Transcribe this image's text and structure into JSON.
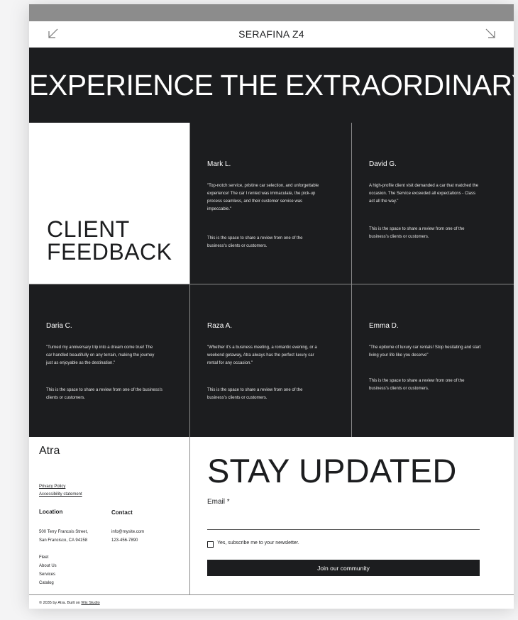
{
  "header": {
    "site_title": "SERAFINA Z4",
    "left_icon": "arrow-down-left-icon",
    "right_icon": "arrow-down-right-icon"
  },
  "hero": {
    "title": "EXPERIENCE THE EXTRAORDINARY"
  },
  "feedback": {
    "title_line1": "CLIENT",
    "title_line2": "FEEDBACK",
    "reviews": [
      {
        "name": "Mark L.",
        "quote": "\"Top-notch service, pristine car selection, and unforgettable experience! The car I rented was immaculate, the pick-up process seamless, and their customer service was impeccable.\"",
        "note": "This is the space to share a review from one of the business's clients or customers."
      },
      {
        "name": "David G.",
        "quote": "A high-profile client visit demanded a car that matched the occasion. The Service exceeded all expectations - Class act all the way.\"",
        "note": "This is the space to share a review from one of the business's clients or customers."
      },
      {
        "name": "Daria C.",
        "quote": "\"Turned my anniversary trip into a dream come true! The car handled beautifully on any terrain, making the journey just as enjoyable as the destination.\"",
        "note": "This is the space to share a review from one of the business's clients or customers."
      },
      {
        "name": "Raza A.",
        "quote": "\"Whether it's a business meeting, a romantic evening, or a weekend getaway, Atra always has the perfect luxury car rental for any occasion.\"",
        "note": "This is the space to share a review from one of the business's clients or customers."
      },
      {
        "name": "Emma D.",
        "quote": "\"The epitome of luxury car rentals! Stop hesitating and start living your life like you deserve\"",
        "note": "This is the space to share a review from one of the business's clients or customers."
      }
    ]
  },
  "footer": {
    "brand": "Atra",
    "links": [
      "Privacy Policy",
      "Accessibility statement"
    ],
    "location_heading": "Location",
    "location_lines": [
      "500 Terry Francois Street,",
      "San Francisco, CA 94158"
    ],
    "contact_heading": "Contact",
    "contact_lines": [
      "info@mysite.com",
      "123-456-7890"
    ],
    "menu": [
      "Fleet",
      "About Us",
      "Services",
      "Catalog"
    ],
    "copyright_prefix": "© 2035 by Atra. Built on",
    "copyright_link": "Wix Studio"
  },
  "newsletter": {
    "title": "STAY UPDATED",
    "email_label": "Email *",
    "email_value": "",
    "checkbox_label": "Yes, subscribe me to your newsletter.",
    "button_label": "Join our community"
  },
  "colors": {
    "dark": "#1c1d1f",
    "divider": "#8a8a8a",
    "top_strip": "#8c8c8c"
  }
}
